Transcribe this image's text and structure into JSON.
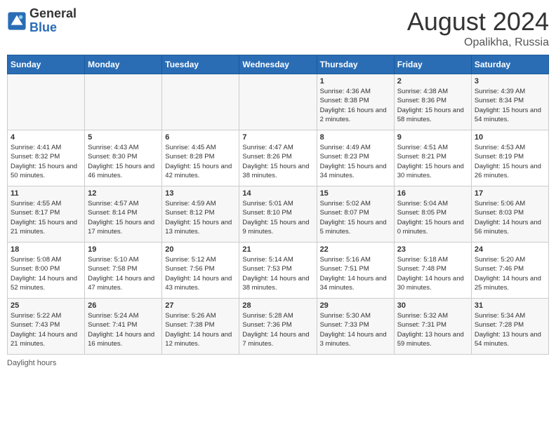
{
  "header": {
    "logo_general": "General",
    "logo_blue": "Blue",
    "main_title": "August 2024",
    "subtitle": "Opalikha, Russia"
  },
  "days_of_week": [
    "Sunday",
    "Monday",
    "Tuesday",
    "Wednesday",
    "Thursday",
    "Friday",
    "Saturday"
  ],
  "weeks": [
    [
      {
        "day": "",
        "info": ""
      },
      {
        "day": "",
        "info": ""
      },
      {
        "day": "",
        "info": ""
      },
      {
        "day": "",
        "info": ""
      },
      {
        "day": "1",
        "info": "Sunrise: 4:36 AM\nSunset: 8:38 PM\nDaylight: 16 hours and 2 minutes."
      },
      {
        "day": "2",
        "info": "Sunrise: 4:38 AM\nSunset: 8:36 PM\nDaylight: 15 hours and 58 minutes."
      },
      {
        "day": "3",
        "info": "Sunrise: 4:39 AM\nSunset: 8:34 PM\nDaylight: 15 hours and 54 minutes."
      }
    ],
    [
      {
        "day": "4",
        "info": "Sunrise: 4:41 AM\nSunset: 8:32 PM\nDaylight: 15 hours and 50 minutes."
      },
      {
        "day": "5",
        "info": "Sunrise: 4:43 AM\nSunset: 8:30 PM\nDaylight: 15 hours and 46 minutes."
      },
      {
        "day": "6",
        "info": "Sunrise: 4:45 AM\nSunset: 8:28 PM\nDaylight: 15 hours and 42 minutes."
      },
      {
        "day": "7",
        "info": "Sunrise: 4:47 AM\nSunset: 8:26 PM\nDaylight: 15 hours and 38 minutes."
      },
      {
        "day": "8",
        "info": "Sunrise: 4:49 AM\nSunset: 8:23 PM\nDaylight: 15 hours and 34 minutes."
      },
      {
        "day": "9",
        "info": "Sunrise: 4:51 AM\nSunset: 8:21 PM\nDaylight: 15 hours and 30 minutes."
      },
      {
        "day": "10",
        "info": "Sunrise: 4:53 AM\nSunset: 8:19 PM\nDaylight: 15 hours and 26 minutes."
      }
    ],
    [
      {
        "day": "11",
        "info": "Sunrise: 4:55 AM\nSunset: 8:17 PM\nDaylight: 15 hours and 21 minutes."
      },
      {
        "day": "12",
        "info": "Sunrise: 4:57 AM\nSunset: 8:14 PM\nDaylight: 15 hours and 17 minutes."
      },
      {
        "day": "13",
        "info": "Sunrise: 4:59 AM\nSunset: 8:12 PM\nDaylight: 15 hours and 13 minutes."
      },
      {
        "day": "14",
        "info": "Sunrise: 5:01 AM\nSunset: 8:10 PM\nDaylight: 15 hours and 9 minutes."
      },
      {
        "day": "15",
        "info": "Sunrise: 5:02 AM\nSunset: 8:07 PM\nDaylight: 15 hours and 5 minutes."
      },
      {
        "day": "16",
        "info": "Sunrise: 5:04 AM\nSunset: 8:05 PM\nDaylight: 15 hours and 0 minutes."
      },
      {
        "day": "17",
        "info": "Sunrise: 5:06 AM\nSunset: 8:03 PM\nDaylight: 14 hours and 56 minutes."
      }
    ],
    [
      {
        "day": "18",
        "info": "Sunrise: 5:08 AM\nSunset: 8:00 PM\nDaylight: 14 hours and 52 minutes."
      },
      {
        "day": "19",
        "info": "Sunrise: 5:10 AM\nSunset: 7:58 PM\nDaylight: 14 hours and 47 minutes."
      },
      {
        "day": "20",
        "info": "Sunrise: 5:12 AM\nSunset: 7:56 PM\nDaylight: 14 hours and 43 minutes."
      },
      {
        "day": "21",
        "info": "Sunrise: 5:14 AM\nSunset: 7:53 PM\nDaylight: 14 hours and 38 minutes."
      },
      {
        "day": "22",
        "info": "Sunrise: 5:16 AM\nSunset: 7:51 PM\nDaylight: 14 hours and 34 minutes."
      },
      {
        "day": "23",
        "info": "Sunrise: 5:18 AM\nSunset: 7:48 PM\nDaylight: 14 hours and 30 minutes."
      },
      {
        "day": "24",
        "info": "Sunrise: 5:20 AM\nSunset: 7:46 PM\nDaylight: 14 hours and 25 minutes."
      }
    ],
    [
      {
        "day": "25",
        "info": "Sunrise: 5:22 AM\nSunset: 7:43 PM\nDaylight: 14 hours and 21 minutes."
      },
      {
        "day": "26",
        "info": "Sunrise: 5:24 AM\nSunset: 7:41 PM\nDaylight: 14 hours and 16 minutes."
      },
      {
        "day": "27",
        "info": "Sunrise: 5:26 AM\nSunset: 7:38 PM\nDaylight: 14 hours and 12 minutes."
      },
      {
        "day": "28",
        "info": "Sunrise: 5:28 AM\nSunset: 7:36 PM\nDaylight: 14 hours and 7 minutes."
      },
      {
        "day": "29",
        "info": "Sunrise: 5:30 AM\nSunset: 7:33 PM\nDaylight: 14 hours and 3 minutes."
      },
      {
        "day": "30",
        "info": "Sunrise: 5:32 AM\nSunset: 7:31 PM\nDaylight: 13 hours and 59 minutes."
      },
      {
        "day": "31",
        "info": "Sunrise: 5:34 AM\nSunset: 7:28 PM\nDaylight: 13 hours and 54 minutes."
      }
    ]
  ],
  "footer": {
    "daylight_label": "Daylight hours"
  }
}
